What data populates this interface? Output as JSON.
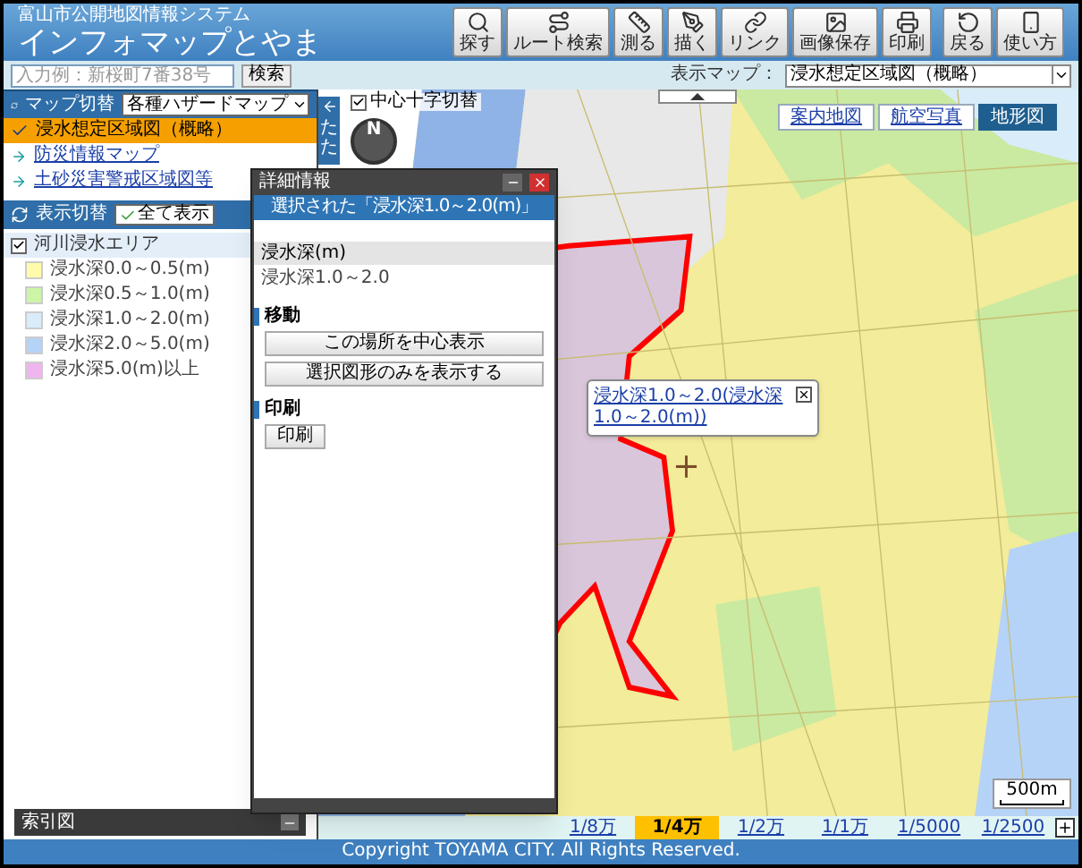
{
  "header": {
    "subtitle": "富山市公開地図情報システム",
    "title": "インフォマップとやま"
  },
  "toolbar": [
    {
      "label": "探す",
      "kind": "search"
    },
    {
      "label": "ルート検索",
      "kind": "route"
    },
    {
      "label": "測る",
      "kind": "measure"
    },
    {
      "label": "描く",
      "kind": "draw"
    },
    {
      "label": "リンク",
      "kind": "link"
    },
    {
      "label": "画像保存",
      "kind": "image"
    },
    {
      "label": "印刷",
      "kind": "print"
    },
    {
      "label": "戻る",
      "kind": "back"
    },
    {
      "label": "使い方",
      "kind": "help"
    }
  ],
  "search": {
    "placeholder": "入力例：新桜町7番38号",
    "button": "検索"
  },
  "display_map": {
    "label": "表示マップ：",
    "value": "浸水想定区域図（概略）"
  },
  "map_switch": {
    "title": "マップ切替",
    "select": "各種ハザードマップ",
    "items": [
      {
        "label": "浸水想定区域図（概略）",
        "selected": true
      },
      {
        "label": "防災情報マップ",
        "selected": false
      },
      {
        "label": "土砂災害警戒区域図等",
        "selected": false
      }
    ]
  },
  "display_switch": {
    "title": "表示切替",
    "button": "全て表示",
    "group": {
      "label": "河川浸水エリア",
      "checked": true,
      "children": [
        {
          "label": "浸水深0.0～0.5(m)",
          "color": "#fffbaa"
        },
        {
          "label": "浸水深0.5～1.0(m)",
          "color": "#ccf5a8"
        },
        {
          "label": "浸水深1.0～2.0(m)",
          "color": "#d8ecfa"
        },
        {
          "label": "浸水深2.0～5.0(m)",
          "color": "#b5d3f7"
        },
        {
          "label": "浸水深5.0(m)以上",
          "color": "#f0b5f0"
        }
      ]
    }
  },
  "index_panel": {
    "title": "索引図"
  },
  "map": {
    "crosshair": {
      "label": "中心十字切替",
      "checked": true
    },
    "collapse_tab": "たた",
    "compass": "N",
    "layers": [
      {
        "label": "案内地図",
        "selected": false
      },
      {
        "label": "航空写真",
        "selected": false
      },
      {
        "label": "地形図",
        "selected": true
      }
    ],
    "popup": "浸水深1.0～2.0(浸水深1.0～2.0(m))",
    "scale_label": "500m"
  },
  "detail_dialog": {
    "title": "詳細情報",
    "subtitle": "選択された「浸水深1.0～2.0(m)」",
    "field": "浸水深(m)",
    "value": "浸水深1.0～2.0",
    "sections": [
      {
        "heading": "移動",
        "buttons": [
          "この場所を中心表示",
          "選択図形のみを表示する"
        ]
      },
      {
        "heading": "印刷",
        "buttons": [
          "印刷"
        ]
      }
    ]
  },
  "scales": [
    {
      "label": "1/8万",
      "selected": false
    },
    {
      "label": "1/4万",
      "selected": true
    },
    {
      "label": "1/2万",
      "selected": false
    },
    {
      "label": "1/1万",
      "selected": false
    },
    {
      "label": "1/5000",
      "selected": false
    },
    {
      "label": "1/2500",
      "selected": false
    }
  ],
  "footer": "Copyright TOYAMA CITY. All Rights Reserved."
}
